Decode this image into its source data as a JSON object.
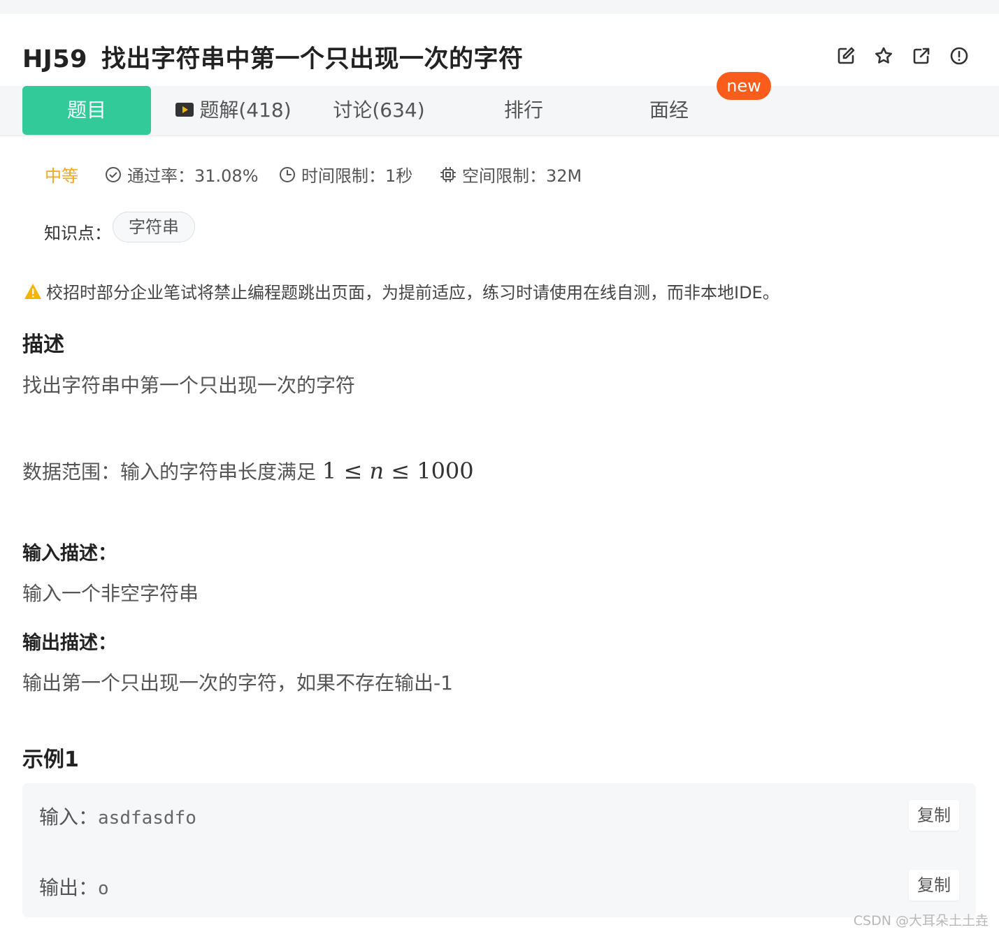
{
  "problem": {
    "code": "HJ59",
    "title": "找出字符串中第一个只出现一次的字符"
  },
  "actions": {
    "edit_icon": "edit-icon",
    "star_icon": "star-icon",
    "share_icon": "external-link-icon",
    "report_icon": "alert-circle-icon"
  },
  "tabs": [
    {
      "label": "题目",
      "active": true
    },
    {
      "label": "题解(418)",
      "icon": "video-icon"
    },
    {
      "label": "讨论(634)"
    },
    {
      "label": "排行"
    },
    {
      "label": "面经"
    }
  ],
  "new_badge": "new",
  "meta": {
    "difficulty": "中等",
    "pass_rate": "通过率：31.08%",
    "time_limit": "时间限制：1秒",
    "space_limit": "空间限制：32M"
  },
  "knowledge": {
    "label": "知识点：",
    "tags": [
      "字符串"
    ]
  },
  "warning": "校招时部分企业笔试将禁止编程题跳出页面，为提前适应，练习时请使用在线自测，而非本地IDE。",
  "description": {
    "heading": "描述",
    "text": "找出字符串中第一个只出现一次的字符",
    "range_prefix": "数据范围：输入的字符串长度满足",
    "range_math_1": "1",
    "range_math_le1": "≤",
    "range_math_n": "n",
    "range_math_le2": "≤",
    "range_math_2": "1000"
  },
  "input_desc": {
    "heading": "输入描述：",
    "text": "输入一个非空字符串"
  },
  "output_desc": {
    "heading": "输出描述：",
    "text": "输出第一个只出现一次的字符，如果不存在输出-1"
  },
  "example": {
    "heading": "示例1",
    "input_label": "输入：",
    "input_value": "asdfasdfo",
    "output_label": "输出：",
    "output_value": "o",
    "copy_label": "复制"
  },
  "watermark": "CSDN @大耳朵土土垚",
  "colors": {
    "accent": "#32ca99",
    "new_badge": "#fa5c1c",
    "difficulty": "#f3a81f",
    "warning": "#f6b400"
  }
}
